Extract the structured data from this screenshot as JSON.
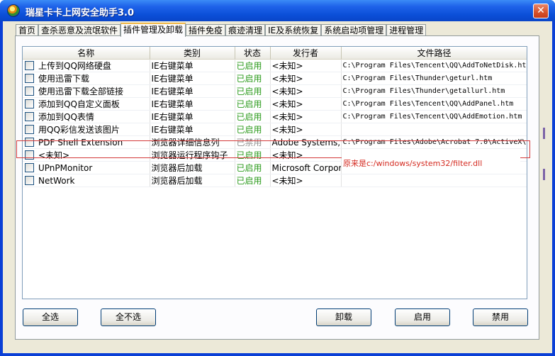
{
  "window": {
    "title": "瑞星卡卡上网安全助手3.0",
    "close_label": "✕"
  },
  "tabs": [
    {
      "label": "首页",
      "active": false
    },
    {
      "label": "查杀恶意及流氓软件",
      "active": false
    },
    {
      "label": "插件管理及卸载",
      "active": true
    },
    {
      "label": "插件免疫",
      "active": false
    },
    {
      "label": "痕迹清理",
      "active": false
    },
    {
      "label": "IE及系统恢复",
      "active": false
    },
    {
      "label": "系统启动项管理",
      "active": false
    },
    {
      "label": "进程管理",
      "active": false
    }
  ],
  "table": {
    "columns": [
      "名称",
      "类别",
      "状态",
      "发行者",
      "文件路径"
    ],
    "rows": [
      {
        "name": "上传到QQ网络硬盘",
        "category": "IE右键菜单",
        "status": "已启用",
        "publisher": "<未知>",
        "path": "C:\\Program Files\\Tencent\\QQ\\AddToNetDisk.ht"
      },
      {
        "name": "使用迅雷下载",
        "category": "IE右键菜单",
        "status": "已启用",
        "publisher": "<未知>",
        "path": "C:\\Program Files\\Thunder\\geturl.htm"
      },
      {
        "name": "使用迅雷下载全部链接",
        "category": "IE右键菜单",
        "status": "已启用",
        "publisher": "<未知>",
        "path": "C:\\Program Files\\Thunder\\getallurl.htm"
      },
      {
        "name": "添加到QQ自定义面板",
        "category": "IE右键菜单",
        "status": "已启用",
        "publisher": "<未知>",
        "path": "C:\\Program Files\\Tencent\\QQ\\AddPanel.htm"
      },
      {
        "name": "添加到QQ表情",
        "category": "IE右键菜单",
        "status": "已启用",
        "publisher": "<未知>",
        "path": "C:\\Program Files\\Tencent\\QQ\\AddEmotion.htm"
      },
      {
        "name": "用QQ彩信发送该图片",
        "category": "IE右键菜单",
        "status": "已启用",
        "publisher": "<未知>",
        "path": ""
      },
      {
        "name": "PDF Shell Extension",
        "category": "浏览器详细信息列",
        "status": "已禁用",
        "publisher": "Adobe Systems, I",
        "path": "C:\\Program Files\\Adobe\\Acrobat 7.0\\ActiveX\\"
      },
      {
        "name": "<未知>",
        "category": "浏览器运行程序钩子",
        "status": "已启用",
        "publisher": "<未知>",
        "path": ""
      },
      {
        "name": "UPnPMonitor",
        "category": "浏览器后加载",
        "status": "已启用",
        "publisher": "Microsoft Corpor",
        "path": ""
      },
      {
        "name": "NetWork",
        "category": "浏览器后加载",
        "status": "已启用",
        "publisher": "<未知>",
        "path": ""
      }
    ]
  },
  "annotation": {
    "note": "原来是c:/windows/system32/filter.dll"
  },
  "buttons": {
    "select_all": "全选",
    "select_none": "全不选",
    "uninstall": "卸载",
    "enable": "启用",
    "disable": "禁用"
  },
  "colors": {
    "status_enabled": "#2c9b1d",
    "status_disabled": "#8e8e8e",
    "highlight": "#d43a3a",
    "titlebar": "#0b4fd8"
  }
}
